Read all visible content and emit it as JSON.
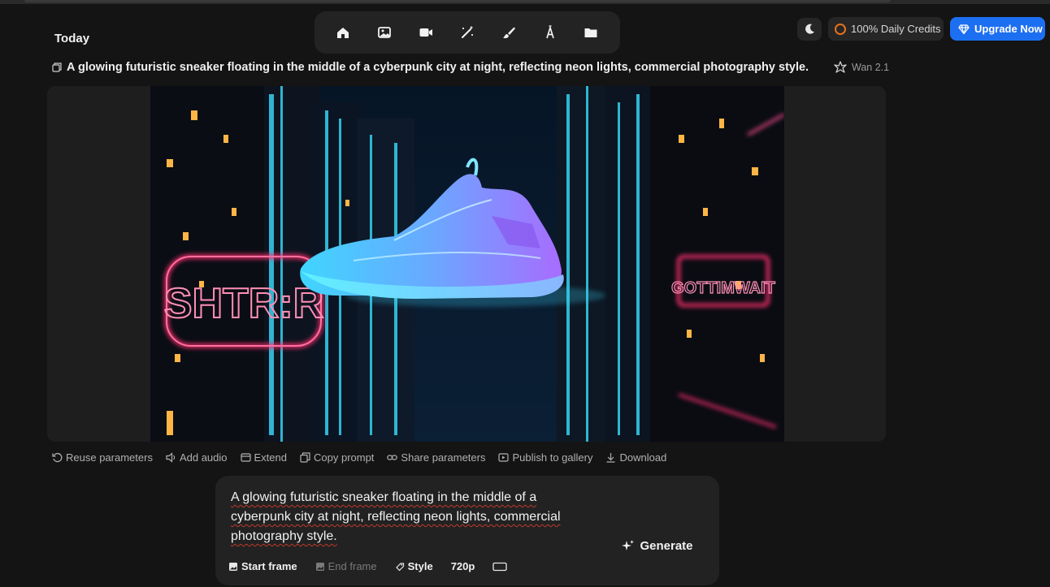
{
  "section_title": "Today",
  "toolbar": {
    "tools": [
      "home-icon",
      "image-icon",
      "video-icon",
      "magic-wand-icon",
      "brush-icon",
      "text-icon",
      "folder-icon"
    ]
  },
  "header": {
    "credits_label": "100% Daily Credits",
    "upgrade_label": "Upgrade Now",
    "accent_color": "#1d6ff2"
  },
  "result": {
    "prompt": "A glowing futuristic sneaker floating in the middle of a cyberpunk city at night, reflecting neon lights, commercial photography style.",
    "model": "Wan 2.1",
    "sign_left": "SHTR:R",
    "sign_right": "GOTTIMWAIT"
  },
  "actions": {
    "reuse": "Reuse parameters",
    "audio": "Add audio",
    "extend": "Extend",
    "copy": "Copy prompt",
    "share": "Share parameters",
    "publish": "Publish to gallery",
    "download": "Download"
  },
  "composer": {
    "text": "A glowing futuristic sneaker floating in the middle of a cyberpunk city at night, reflecting neon lights, commercial photography style.",
    "generate_label": "Generate",
    "start_frame": "Start frame",
    "end_frame": "End frame",
    "style": "Style",
    "resolution": "720p"
  }
}
